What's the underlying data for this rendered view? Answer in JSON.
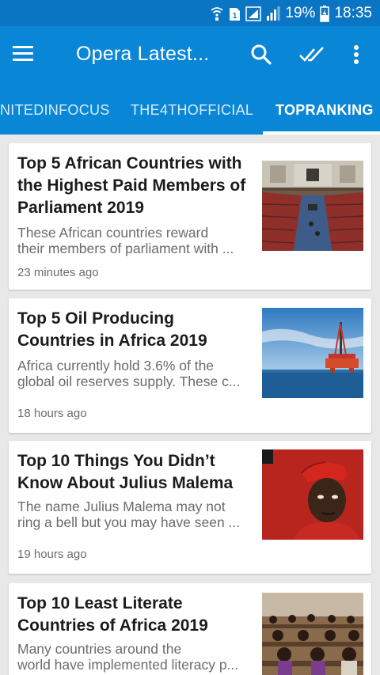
{
  "status_bar": {
    "battery_percent": "19%",
    "time": "18:35"
  },
  "app_bar": {
    "title": "Opera Latest...",
    "icons": [
      "menu-icon",
      "search-icon",
      "mark-all-read-icon",
      "more-vert-icon"
    ]
  },
  "tabs": [
    {
      "label": "NITEDINFOCUS",
      "active": false
    },
    {
      "label": "THE4THOFFICIAL",
      "active": false
    },
    {
      "label": "TOPRANKING",
      "active": true
    }
  ],
  "articles": [
    {
      "title": "Top 5 African Countries with the Highest Paid Members of Parliament 2019",
      "snippet_lines": [
        "These African countries reward",
        "their members of parliament with ..."
      ],
      "time": "23 minutes ago",
      "thumbnail": "parliament-chamber-image"
    },
    {
      "title": "Top 5 Oil Producing Countries in Africa 2019",
      "snippet_lines": [
        "Africa currently hold 3.6% of the",
        "global oil reserves supply. These c..."
      ],
      "time": "18 hours ago",
      "thumbnail": "offshore-oil-rig-image"
    },
    {
      "title": "Top 10 Things You Didn’t Know About Julius Malema",
      "snippet_lines": [
        "The name Julius Malema may not",
        "ring a bell but you may have seen ..."
      ],
      "time": "19 hours ago",
      "thumbnail": "man-red-beret-image"
    },
    {
      "title": "Top 10 Least Literate Countries of Africa 2019",
      "snippet_lines": [
        "Many countries around the",
        "world have implemented literacy p..."
      ],
      "time": "",
      "thumbnail": "students-exam-hall-image"
    }
  ],
  "colors": {
    "status_bar": "#0a76c3",
    "app_bar": "#0a86d6",
    "background": "#e8e8e8",
    "card": "#ffffff",
    "title_text": "#1b1b1b",
    "secondary_text": "#6b6b6b"
  }
}
